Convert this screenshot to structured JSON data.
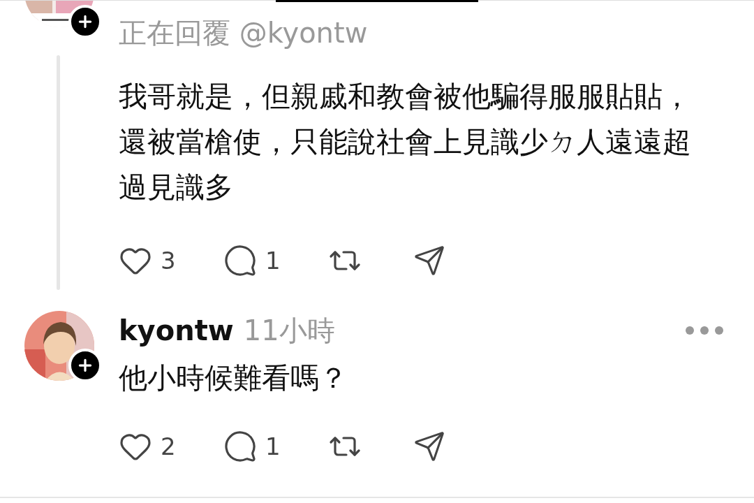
{
  "posts": [
    {
      "kind": "draft",
      "header": "正在回覆 @kyontw",
      "body": "我哥就是，但親戚和教會被他騙得服服貼貼，還被當槍使，只能說社會上見識少ㄉ人遠遠超過見識多",
      "likes": "3",
      "comments": "1"
    },
    {
      "kind": "comment",
      "author": "kyontw",
      "time": "11小時",
      "body": "他小時候難看嗎？",
      "likes": "2",
      "comments": "1"
    }
  ]
}
